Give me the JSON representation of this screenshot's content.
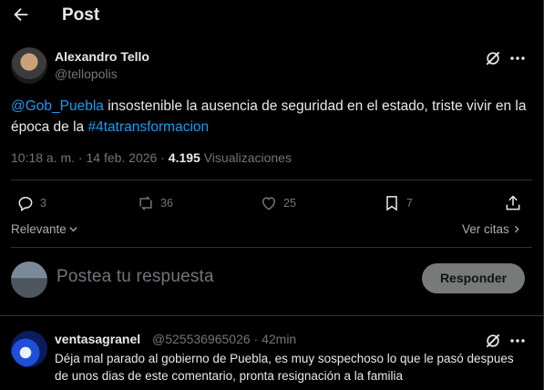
{
  "header": {
    "title": "Post"
  },
  "post": {
    "author_name": "Alexandro Tello",
    "author_handle": "@tellopolis",
    "text_mention": "@Gob_Puebla",
    "text_body": " insostenible la ausencia de seguridad en el estado, triste vivir en la época de la ",
    "text_hashtag": "#4tatransformacion",
    "time": "10:18 a. m. · 14 feb. 2026 · ",
    "views_count": "4.195",
    "views_label": " Visualizaciones"
  },
  "actions": {
    "replies": "3",
    "reposts": "36",
    "likes": "25",
    "bookmarks": "7"
  },
  "sort": {
    "label": "Relevante"
  },
  "quotes": {
    "label": "Ver citas"
  },
  "reply_box": {
    "placeholder": "Postea tu respuesta",
    "button_label": "Responder"
  },
  "comment": {
    "author_name": "ventasagranel",
    "author_handle": "@525536965026 · 42min",
    "text": "Déja mal parado al gobierno de Puebla, es muy sospechoso lo que le pasó despues de unos dias de este comentario, pronta resignación a la familia"
  },
  "colors": {
    "accent": "#1d9bf0",
    "background": "#000000",
    "muted": "#71767b",
    "divider": "#2f3336"
  },
  "icons": [
    "back-arrow-icon",
    "grok-icon",
    "more-icon",
    "reply-icon",
    "repost-icon",
    "like-icon",
    "bookmark-icon",
    "share-icon",
    "chevron-down-icon",
    "chevron-right-icon"
  ]
}
